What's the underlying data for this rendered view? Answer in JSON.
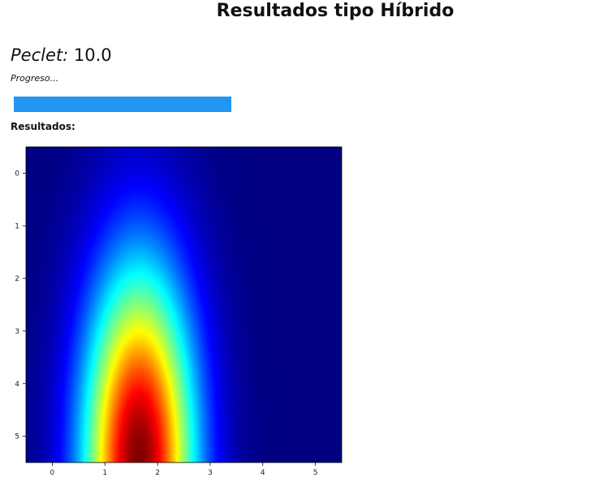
{
  "page": {
    "title": "Resultados tipo Híbrido",
    "peclet_label": "Peclet:",
    "peclet_value": "10.0",
    "progress_label": "Progreso...",
    "progress_fraction": 1.0,
    "results_label": "Resultados:"
  },
  "colors": {
    "progress_fill": "#2196f3",
    "progress_track": "#e8e8e8"
  },
  "chart_data": {
    "type": "heatmap",
    "colormap": "jet",
    "xlim": [
      -0.5,
      5.5
    ],
    "ylim": [
      -0.5,
      5.5
    ],
    "y_inverted": true,
    "x_ticks": [
      0,
      1,
      2,
      3,
      4,
      5
    ],
    "y_ticks": [
      0,
      1,
      2,
      3,
      4,
      5
    ],
    "x_tick_labels": [
      "0",
      "1",
      "2",
      "3",
      "4",
      "5"
    ],
    "y_tick_labels": [
      "0",
      "1",
      "2",
      "3",
      "4",
      "5"
    ],
    "peak": {
      "x": 1.65,
      "y": 5.5,
      "value": 1.0
    },
    "grid": false
  }
}
